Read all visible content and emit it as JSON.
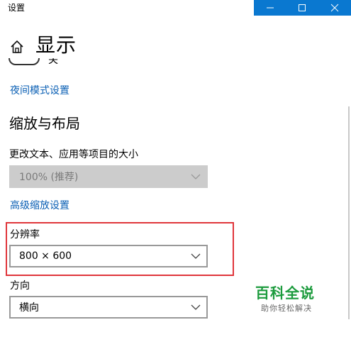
{
  "window": {
    "title": "设置"
  },
  "header": {
    "title": "显示"
  },
  "partial_item": {
    "label": "关"
  },
  "links": {
    "night_light": "夜间模式设置",
    "advanced_scaling": "高级缩放设置"
  },
  "section": {
    "heading": "缩放与布局"
  },
  "scale": {
    "label": "更改文本、应用等项目的大小",
    "value": "100% (推荐)"
  },
  "resolution": {
    "label": "分辨率",
    "value": "800 × 600"
  },
  "orientation": {
    "label": "方向",
    "value": "横向"
  },
  "watermark": {
    "main": "百科全说",
    "sub": "助你轻松解决"
  },
  "colors": {
    "accent": "#0a78d0",
    "link": "#0a5fb4",
    "highlight": "#e0363b",
    "watermark": "#1c9b3d"
  }
}
